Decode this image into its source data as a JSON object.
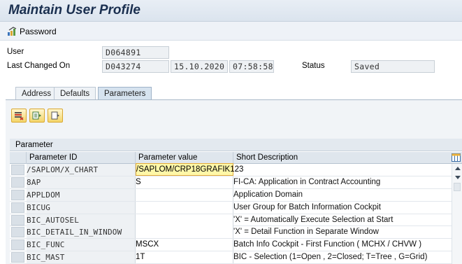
{
  "title": "Maintain User Profile",
  "toolbar": {
    "password_label": "Password"
  },
  "form": {
    "user_label": "User",
    "user_value": "D064891",
    "last_changed_label": "Last Changed On",
    "last_changed_by": "D043274",
    "last_changed_date": "15.10.2020",
    "last_changed_time": "07:58:58",
    "status_label": "Status",
    "status_value": "Saved"
  },
  "tabs": [
    {
      "label": "Address"
    },
    {
      "label": "Defaults"
    },
    {
      "label": "Parameters",
      "active": true
    }
  ],
  "grid": {
    "title": "Parameter",
    "headers": {
      "id": "Parameter ID",
      "value": "Parameter value",
      "desc": "Short Description"
    },
    "rows": [
      {
        "id": "/SAPLOM/X_CHART",
        "value": "/SAPLOM/CRP18GRAFIK123",
        "desc": ""
      },
      {
        "id": "8AP",
        "value": "S",
        "desc": "FI-CA: Application in Contract Accounting"
      },
      {
        "id": "APPLDOM",
        "value": "",
        "desc": "Application Domain"
      },
      {
        "id": "BICUG",
        "value": "",
        "desc": "User Group for Batch Information Cockpit"
      },
      {
        "id": "BIC_AUTOSEL",
        "value": "",
        "desc": "'X' = Automatically Execute Selection at Start"
      },
      {
        "id": "BIC_DETAIL_IN_WINDOW",
        "value": "",
        "desc": "'X' = Detail Function in Separate Window"
      },
      {
        "id": "BIC_FUNC",
        "value": "MSCX",
        "desc": "Batch Info Cockpit - First Function ( MCHX / CHVW )"
      },
      {
        "id": "BIC_MAST",
        "value": "1T",
        "desc": "BIC - Selection (1=Open , 2=Closed; T=Tree , G=Grid)"
      }
    ]
  },
  "icons": {
    "password": "password-key-icon",
    "btn1": "delete-row-icon",
    "btn2": "insert-row-icon",
    "btn3": "details-icon",
    "col_config": "column-layout-icon"
  },
  "colors": {
    "title_text": "#1a2f4f",
    "edit_cell": "#fff8a8",
    "button_border": "#d9a730"
  }
}
